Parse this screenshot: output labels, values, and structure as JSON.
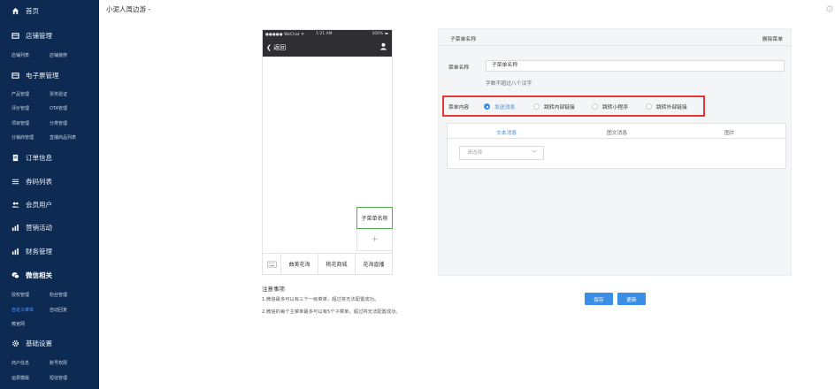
{
  "header": {
    "title": "小泥人周边游 -",
    "right_icon": "info-circle-icon"
  },
  "sidebar": {
    "sections": [
      {
        "label": "首页",
        "icon": "home-icon",
        "subs": []
      },
      {
        "label": "店铺管理",
        "icon": "card-icon",
        "subs": [
          [
            "店铺列表",
            "店铺装修"
          ]
        ]
      },
      {
        "label": "电子票管理",
        "icon": "card-icon",
        "subs": [
          [
            "产品管理",
            "票务验证"
          ],
          [
            "评价管理",
            "OTA管理"
          ],
          [
            "项目管理",
            "分类管理"
          ],
          [
            "分销商管理",
            "直播商品列表"
          ]
        ]
      },
      {
        "label": "订单信息",
        "icon": "document-icon",
        "subs": []
      },
      {
        "label": "券码列表",
        "icon": "list-icon",
        "subs": []
      },
      {
        "label": "会员用户",
        "icon": "users-icon",
        "subs": []
      },
      {
        "label": "营销活动",
        "icon": "bar-chart-icon",
        "subs": []
      },
      {
        "label": "财务管理",
        "icon": "bar-chart-icon",
        "subs": []
      },
      {
        "label": "微信相关",
        "icon": "wechat-icon",
        "subs": [
          [
            "授权管理",
            "粉丝管理"
          ],
          [
            "自定义菜单",
            "自动回复"
          ],
          [
            "微官网"
          ]
        ]
      },
      {
        "label": "基础设置",
        "icon": "gear-icon",
        "subs": [
          [
            "商户信息",
            "账号权限"
          ],
          [
            "运费模版",
            "短信管理"
          ]
        ]
      }
    ],
    "active_section": "微信相关",
    "active_sub": "自定义菜单"
  },
  "phone": {
    "status_left": "●●●●● WeChat ᯤ",
    "status_time": "1:21 AM",
    "status_right": "100% ▬",
    "back_label": "返回",
    "sub_menu_label": "子菜单名称",
    "add_symbol": "+",
    "menu_items": [
      "曲美花海",
      "桃花商城",
      "花海直播"
    ]
  },
  "notes": {
    "title": "注意事项",
    "items": [
      "1.微信最多可以有三个一级菜单，超过将无法配置成功。",
      "2.微信的每个主菜单最多可以有5个子菜单，超过将无法配置成功。"
    ]
  },
  "panel": {
    "title": "子菜单名称",
    "delete_label": "删除菜单",
    "name_label": "菜单名称",
    "name_value": "子菜单名称",
    "hint": "字数不超过八个汉字",
    "content_label": "菜单内容",
    "radio_options": [
      "发送消息",
      "跳转内部链接",
      "跳转小程序",
      "跳转外部链接"
    ],
    "selected_option": "发送消息",
    "content_tabs": [
      "文本消息",
      "图文消息",
      "图片"
    ],
    "active_tab": "文本消息",
    "select_placeholder": "请选择"
  },
  "buttons": {
    "save": "保存",
    "update": "更新"
  },
  "colors": {
    "sidebar_bg": "#0d2a52",
    "accent": "#3a8ee6",
    "highlight_border": "#e53935",
    "selected_submenu_border": "#4caf50"
  }
}
